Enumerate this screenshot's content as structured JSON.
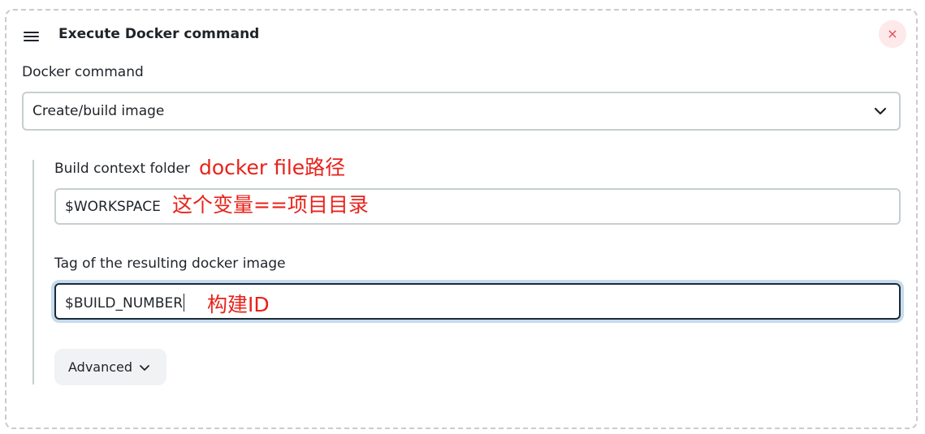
{
  "header": {
    "title": "Execute Docker command",
    "close_glyph": "×",
    "handle_icon": "drag-handle-icon",
    "close_icon": "close-icon"
  },
  "docker_command": {
    "label": "Docker command",
    "selected": "Create/build image",
    "chevron_icon": "chevron-down-icon"
  },
  "build_context": {
    "label": "Build context folder",
    "value": "$WORKSPACE",
    "annotation": "docker file路径"
  },
  "tag": {
    "label": "Tag of the resulting docker image",
    "value": "$BUILD_NUMBER",
    "annotation": "构建ID"
  },
  "build_context_value_annotation": "这个变量==项目目录",
  "advanced": {
    "label": "Advanced",
    "chevron_icon": "chevron-down-icon"
  },
  "colors": {
    "annotation": "#e8221b",
    "close_bg": "#fde8ea",
    "close_fg": "#e5484d",
    "focus_ring": "#c6dced",
    "input_border": "#c7ced1"
  }
}
